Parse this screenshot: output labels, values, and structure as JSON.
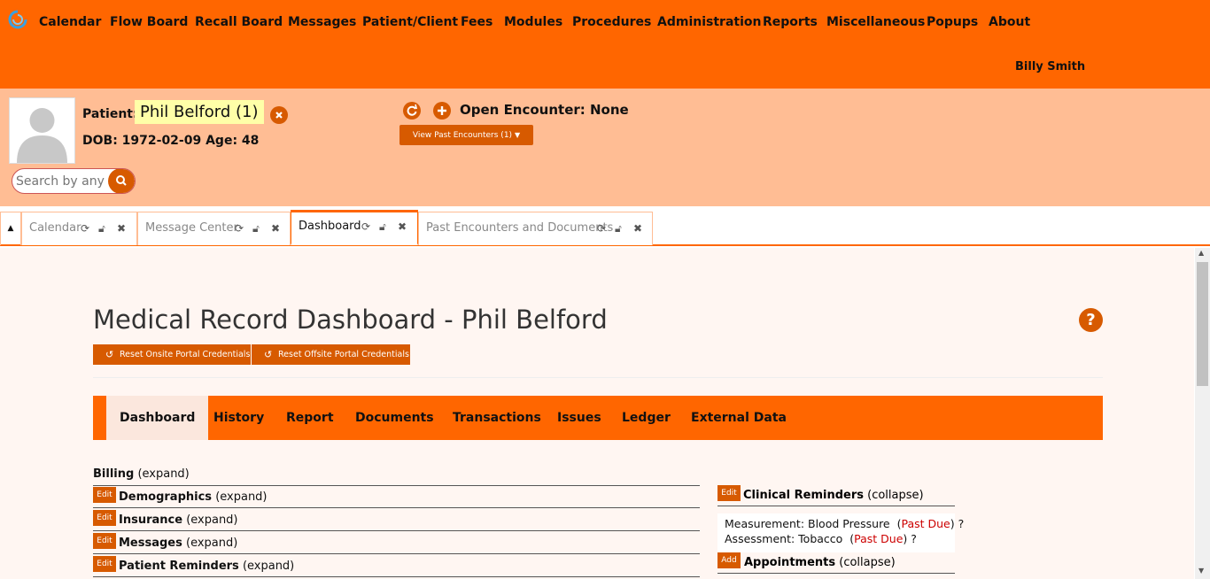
{
  "menu": {
    "items": [
      "Calendar",
      "Flow Board",
      "Recall Board",
      "Messages",
      "Patient/Client",
      "Fees",
      "Modules",
      "Procedures",
      "Administration",
      "Reports",
      "Miscellaneous",
      "Popups",
      "About"
    ],
    "user": "Billy Smith"
  },
  "patient": {
    "label": "Patient:",
    "name": "Phil Belford (1)",
    "dob_line": "DOB: 1972-02-09 Age: 48",
    "search_placeholder": "Search by any",
    "open_encounter": "Open Encounter: None",
    "past_encounters_button": "View Past Encounters  (1)"
  },
  "tabs": [
    {
      "label": "Calendar",
      "active": false
    },
    {
      "label": "Message Center",
      "active": false
    },
    {
      "label": "Dashboard",
      "active": true
    },
    {
      "label": "Past Encounters and Documents",
      "active": false
    }
  ],
  "dashboard": {
    "title": "Medical Record Dashboard - Phil Belford",
    "reset_onsite": "Reset Onsite Portal Credentials",
    "reset_offsite": "Reset Offsite Portal Credentials",
    "nav": [
      "Dashboard",
      "History",
      "Report",
      "Documents",
      "Transactions",
      "Issues",
      "Ledger",
      "External Data"
    ],
    "sections_left": [
      {
        "button": "",
        "title": "Billing",
        "toggle": "(expand)"
      },
      {
        "button": "Edit",
        "title": "Demographics",
        "toggle": "(expand)"
      },
      {
        "button": "Edit",
        "title": "Insurance",
        "toggle": "(expand)"
      },
      {
        "button": "Edit",
        "title": "Messages",
        "toggle": "(expand)"
      },
      {
        "button": "Edit",
        "title": "Patient Reminders",
        "toggle": "(expand)"
      }
    ],
    "sections_right": [
      {
        "button": "Edit",
        "title": "Clinical Reminders",
        "toggle": "(collapse)"
      },
      {
        "button": "Add",
        "title": "Appointments",
        "toggle": "(collapse)"
      }
    ],
    "reminders": [
      {
        "text": "Measurement: Blood Pressure",
        "status": "Past Due",
        "suffix": "?"
      },
      {
        "text": "Assessment: Tobacco",
        "status": "Past Due",
        "suffix": "?"
      }
    ]
  },
  "colors": {
    "primary": "#ff6600",
    "patient_bar": "#ffbd94",
    "button": "#d75a00",
    "highlight": "#ffffa8",
    "past_due": "#cc0000"
  }
}
